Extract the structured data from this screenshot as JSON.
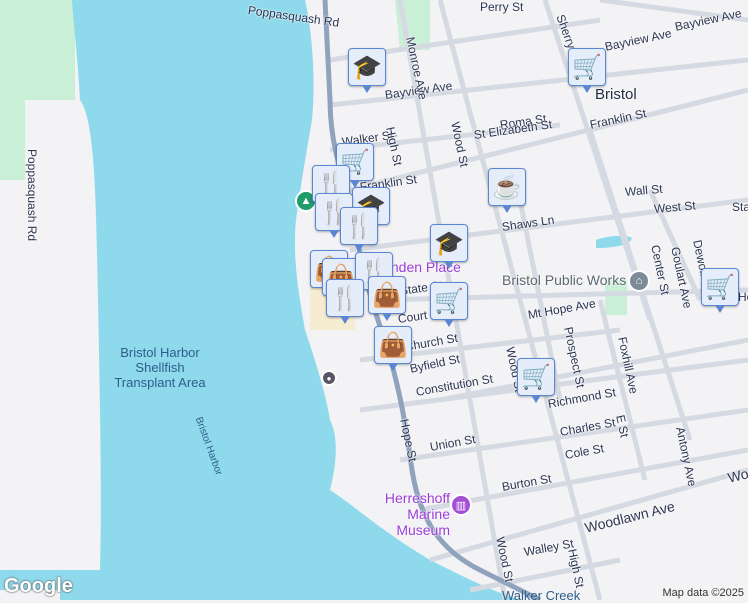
{
  "map": {
    "town": "Bristol",
    "streets": [
      "Poppasquash Rd",
      "Poppasquash Rd",
      "Perry St",
      "Sherry Ave",
      "Bayview Ave",
      "Bayview Ave",
      "Bayview Ave",
      "Monroe Ave",
      "Roma St",
      "St Elizabeth St",
      "Franklin St",
      "Franklin St",
      "Walker St",
      "Wood St",
      "High St",
      "Wall St",
      "West St",
      "Shaws Ln",
      "Sta",
      "Mt Hope Ave",
      "Ho",
      "Center St",
      "Goulart Ave",
      "Dewolf Ave",
      "Prospect St",
      "Foxhill Ave",
      "State St",
      "Court St",
      "Church St",
      "Byfield St",
      "Constitution St",
      "Richmond St",
      "E St",
      "Charles St",
      "Union St",
      "Cole St",
      "Antony Ave",
      "Burton St",
      "Hope St",
      "Woodlawn Ave",
      "Wo",
      "Walley St",
      "Wood St",
      "High St",
      "Wood St"
    ],
    "water_labels": [
      "Bristol Harbor Shellfish Transplant Area",
      "Bristol Harbor",
      "Walker Creek"
    ],
    "pois": {
      "linden": "Linden Place",
      "public_works": "Bristol Public Works",
      "museum": "Herreshoff Marine Museum"
    },
    "markers": [
      {
        "type": "school",
        "icon": "graduation-cap-icon",
        "glyph": "🎓"
      },
      {
        "type": "grocery",
        "icon": "cart-icon",
        "glyph": "🛒"
      },
      {
        "type": "grocery",
        "icon": "cart-icon",
        "glyph": "🛒"
      },
      {
        "type": "restaurant",
        "icon": "fork-knife-icon",
        "glyph": "🍴"
      },
      {
        "type": "school",
        "icon": "graduation-cap-icon",
        "glyph": "🎓"
      },
      {
        "type": "restaurant",
        "icon": "fork-knife-icon",
        "glyph": "🍴"
      },
      {
        "type": "restaurant",
        "icon": "fork-knife-icon",
        "glyph": "🍴"
      },
      {
        "type": "cafe",
        "icon": "coffee-cup-icon",
        "glyph": "☕"
      },
      {
        "type": "school",
        "icon": "graduation-cap-icon",
        "glyph": "🎓"
      },
      {
        "type": "shopping",
        "icon": "shopping-bag-icon",
        "glyph": "👜"
      },
      {
        "type": "shopping",
        "icon": "shopping-bag-icon",
        "glyph": "👜"
      },
      {
        "type": "restaurant",
        "icon": "fork-knife-icon",
        "glyph": "🍴"
      },
      {
        "type": "shopping",
        "icon": "shopping-bag-icon",
        "glyph": "👜"
      },
      {
        "type": "grocery",
        "icon": "cart-icon",
        "glyph": "🛒"
      },
      {
        "type": "restaurant",
        "icon": "fork-knife-icon",
        "glyph": "🍴"
      },
      {
        "type": "shopping",
        "icon": "shopping-bag-icon",
        "glyph": "👜"
      },
      {
        "type": "grocery",
        "icon": "cart-icon",
        "glyph": "🛒"
      },
      {
        "type": "grocery",
        "icon": "cart-icon",
        "glyph": "🛒"
      }
    ]
  },
  "footer": {
    "logo": "Google",
    "attribution": "Map data ©2025"
  }
}
